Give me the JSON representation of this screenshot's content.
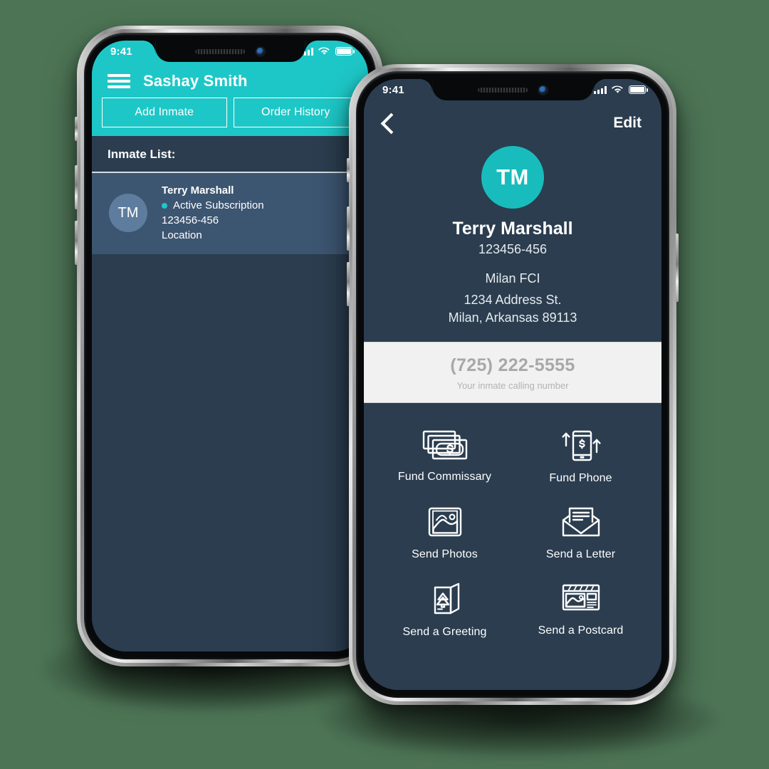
{
  "canvas": {
    "background": "#4d7455"
  },
  "theme": {
    "teal": "#1ec7c7",
    "navy": "#2b3d4f",
    "row_navy": "#3c5571",
    "avatar_teal": "#19bcbc",
    "avatar_slate": "#5e7d9e",
    "card_gray": "#f1f1f1",
    "muted_gray": "#a8a8a8"
  },
  "left_phone": {
    "status_bar": {
      "time": "9:41",
      "signal_icon": "cellular-bars-icon",
      "wifi_icon": "wifi-icon",
      "battery_icon": "battery-icon"
    },
    "nav": {
      "menu_icon": "hamburger-menu-icon",
      "title": "Sashay Smith"
    },
    "actions": [
      {
        "label": "Add Inmate",
        "name": "add-inmate-button"
      },
      {
        "label": "Order History",
        "name": "order-history-button"
      }
    ],
    "list_header": "Inmate List:",
    "inmates": [
      {
        "initials": "TM",
        "name": "Terry Marshall",
        "status": "Active Subscription",
        "status_color": "#1ec7c7",
        "id": "123456-456",
        "location": "Location"
      }
    ]
  },
  "right_phone": {
    "status_bar": {
      "time": "9:41",
      "signal_icon": "cellular-bars-icon",
      "wifi_icon": "wifi-icon",
      "battery_icon": "battery-icon"
    },
    "nav": {
      "back_icon": "chevron-left-icon",
      "edit_label": "Edit"
    },
    "profile": {
      "initials": "TM",
      "name": "Terry Marshall",
      "id": "123456-456",
      "facility": "Milan FCI",
      "address_line1": "1234 Address St.",
      "address_line2": "Milan, Arkansas 89113"
    },
    "calling_card": {
      "number": "(725) 222-5555",
      "caption": "Your inmate calling number"
    },
    "actions": [
      {
        "label": "Fund Commissary",
        "icon": "cash-bills-icon",
        "name": "fund-commissary-action"
      },
      {
        "label": "Fund Phone",
        "icon": "phone-dollar-icon",
        "name": "fund-phone-action"
      },
      {
        "label": "Send Photos",
        "icon": "photo-icon",
        "name": "send-photos-action"
      },
      {
        "label": "Send a Letter",
        "icon": "envelope-letter-icon",
        "name": "send-a-letter-action"
      },
      {
        "label": "Send a Greeting",
        "icon": "greeting-card-icon",
        "name": "send-a-greeting-action"
      },
      {
        "label": "Send a Postcard",
        "icon": "postcard-icon",
        "name": "send-a-postcard-action"
      }
    ]
  }
}
